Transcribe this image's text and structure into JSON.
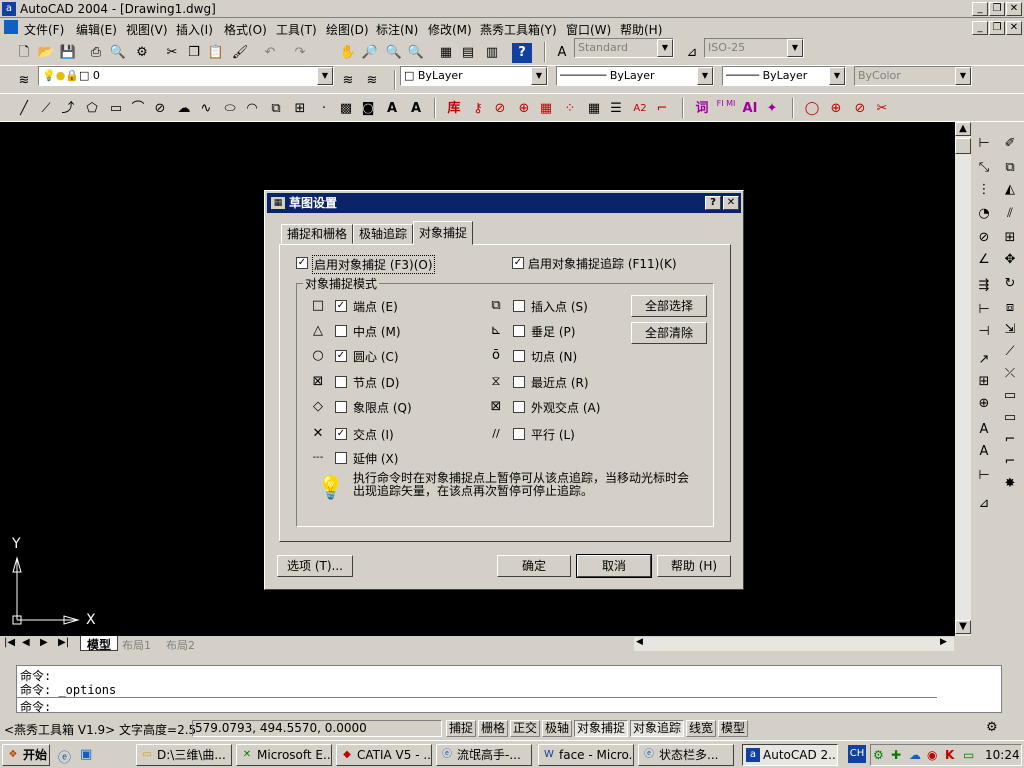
{
  "window": {
    "title": "AutoCAD 2004 - [Drawing1.dwg]"
  },
  "menu": [
    "文件(F)",
    "编辑(E)",
    "视图(V)",
    "插入(I)",
    "格式(O)",
    "工具(T)",
    "绘图(D)",
    "标注(N)",
    "修改(M)",
    "燕秀工具箱(Y)",
    "窗口(W)",
    "帮助(H)"
  ],
  "toolbar": {
    "text_style": "Standard",
    "dim_style": "ISO-25",
    "layer": "0",
    "color": "ByLayer",
    "linetype": "ByLayer",
    "lineweight": "ByLayer",
    "plotstyle": "ByColor",
    "misc": [
      "库",
      "词",
      "FI MI",
      "AI"
    ]
  },
  "layout_tabs": [
    "模型",
    "布局1",
    "布局2"
  ],
  "canvas": {
    "y_axis": "Y",
    "x_axis": "X"
  },
  "dialog": {
    "title": "草图设置",
    "tabs": [
      "捕捉和栅格",
      "极轴追踪",
      "对象捕捉"
    ],
    "enable_osnap": "启用对象捕捉 (F3)(O)",
    "enable_tracking": "启用对象捕捉追踪 (F11)(K)",
    "group_title": "对象捕捉模式",
    "modes_left": [
      {
        "sym": "□",
        "label": "端点 (E)",
        "checked": true
      },
      {
        "sym": "△",
        "label": "中点 (M)",
        "checked": false
      },
      {
        "sym": "○",
        "label": "圆心 (C)",
        "checked": true
      },
      {
        "sym": "⊠",
        "label": "节点 (D)",
        "checked": false
      },
      {
        "sym": "◇",
        "label": "象限点 (Q)",
        "checked": false
      },
      {
        "sym": "✕",
        "label": "交点 (I)",
        "checked": true
      },
      {
        "sym": "---",
        "label": "延伸 (X)",
        "checked": false
      }
    ],
    "modes_right": [
      {
        "sym": "⧉",
        "label": "插入点 (S)",
        "checked": false
      },
      {
        "sym": "⊾",
        "label": "垂足 (P)",
        "checked": false
      },
      {
        "sym": "ō",
        "label": "切点 (N)",
        "checked": false
      },
      {
        "sym": "⧖",
        "label": "最近点 (R)",
        "checked": false
      },
      {
        "sym": "⊠",
        "label": "外观交点 (A)",
        "checked": false
      },
      {
        "sym": "//",
        "label": "平行 (L)",
        "checked": false
      }
    ],
    "select_all": "全部选择",
    "clear_all": "全部清除",
    "hint": "执行命令时在对象捕捉点上暂停可从该点追踪，当移动光标时会出现追踪矢量，在该点再次暂停可停止追踪。",
    "options": "选项 (T)...",
    "ok": "确定",
    "cancel": "取消",
    "help": "帮助 (H)"
  },
  "command": {
    "line1": "命令:",
    "line2": "命令: _options",
    "prompt": "命令:"
  },
  "status": {
    "info": "<燕秀工具箱 V1.9> 文字高度=2.5",
    "coords": "579.0793,  494.5570, 0.0000",
    "buttons": [
      "捕捉",
      "栅格",
      "正交",
      "极轴",
      "对象捕捉",
      "对象追踪",
      "线宽",
      "模型"
    ]
  },
  "taskbar": {
    "start": "开始",
    "items": [
      "D:\\三维\\曲...",
      "Microsoft E...",
      "CATIA V5 - ...",
      "流氓高手-...",
      "face - Micro...",
      "状态栏多...",
      "AutoCAD 2..."
    ],
    "lang": "CH",
    "clock": "10:24"
  }
}
